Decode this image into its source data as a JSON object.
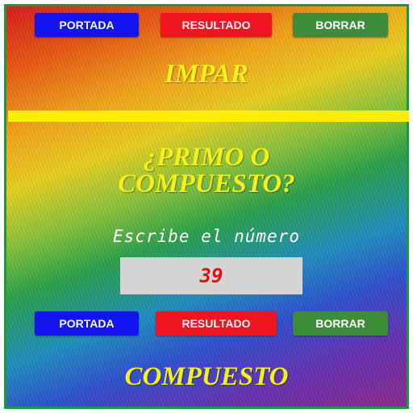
{
  "top_buttons": {
    "portada": "PORTADA",
    "resultado": "RESULTADO",
    "borrar": "BORRAR"
  },
  "parity_result": "IMPAR",
  "question": {
    "line1": "¿PRIMO O",
    "line2": "COMPUESTO?"
  },
  "input": {
    "label": "Escribe el número",
    "value": "39"
  },
  "bottom_buttons": {
    "portada": "PORTADA",
    "resultado": "RESULTADO",
    "borrar": "BORRAR"
  },
  "final_result": "COMPUESTO",
  "colors": {
    "title_yellow": "#f5f01a",
    "bar_yellow": "#ffee00",
    "blue_button": "#1414f0",
    "red_button": "#f0141e",
    "green_button": "#3d8c3a",
    "number_red": "#e01010",
    "frame_green": "#1a9a3a"
  }
}
